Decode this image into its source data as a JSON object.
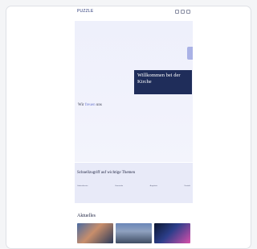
{
  "header": {
    "logo": "PUZZLE",
    "icons": [
      "search-icon",
      "user-icon",
      "menu-icon"
    ]
  },
  "hero": {
    "welcome_title": "Willkommen bei der Kirche",
    "promo_prefix": "Wir ",
    "promo_highlight": "freuen",
    "promo_suffix": " uns"
  },
  "topics": {
    "title": "Schnellzugriff auf wichtige Themen",
    "items": [
      "Gottesdienste",
      "Gemeinde",
      "Angebote",
      "Kontakt"
    ]
  },
  "news": {
    "title": "Aktuelles"
  },
  "colors": {
    "accent": "#1f2d5a",
    "hero_bg": "#eef0fb",
    "topics_bg": "#e8eaf8"
  }
}
